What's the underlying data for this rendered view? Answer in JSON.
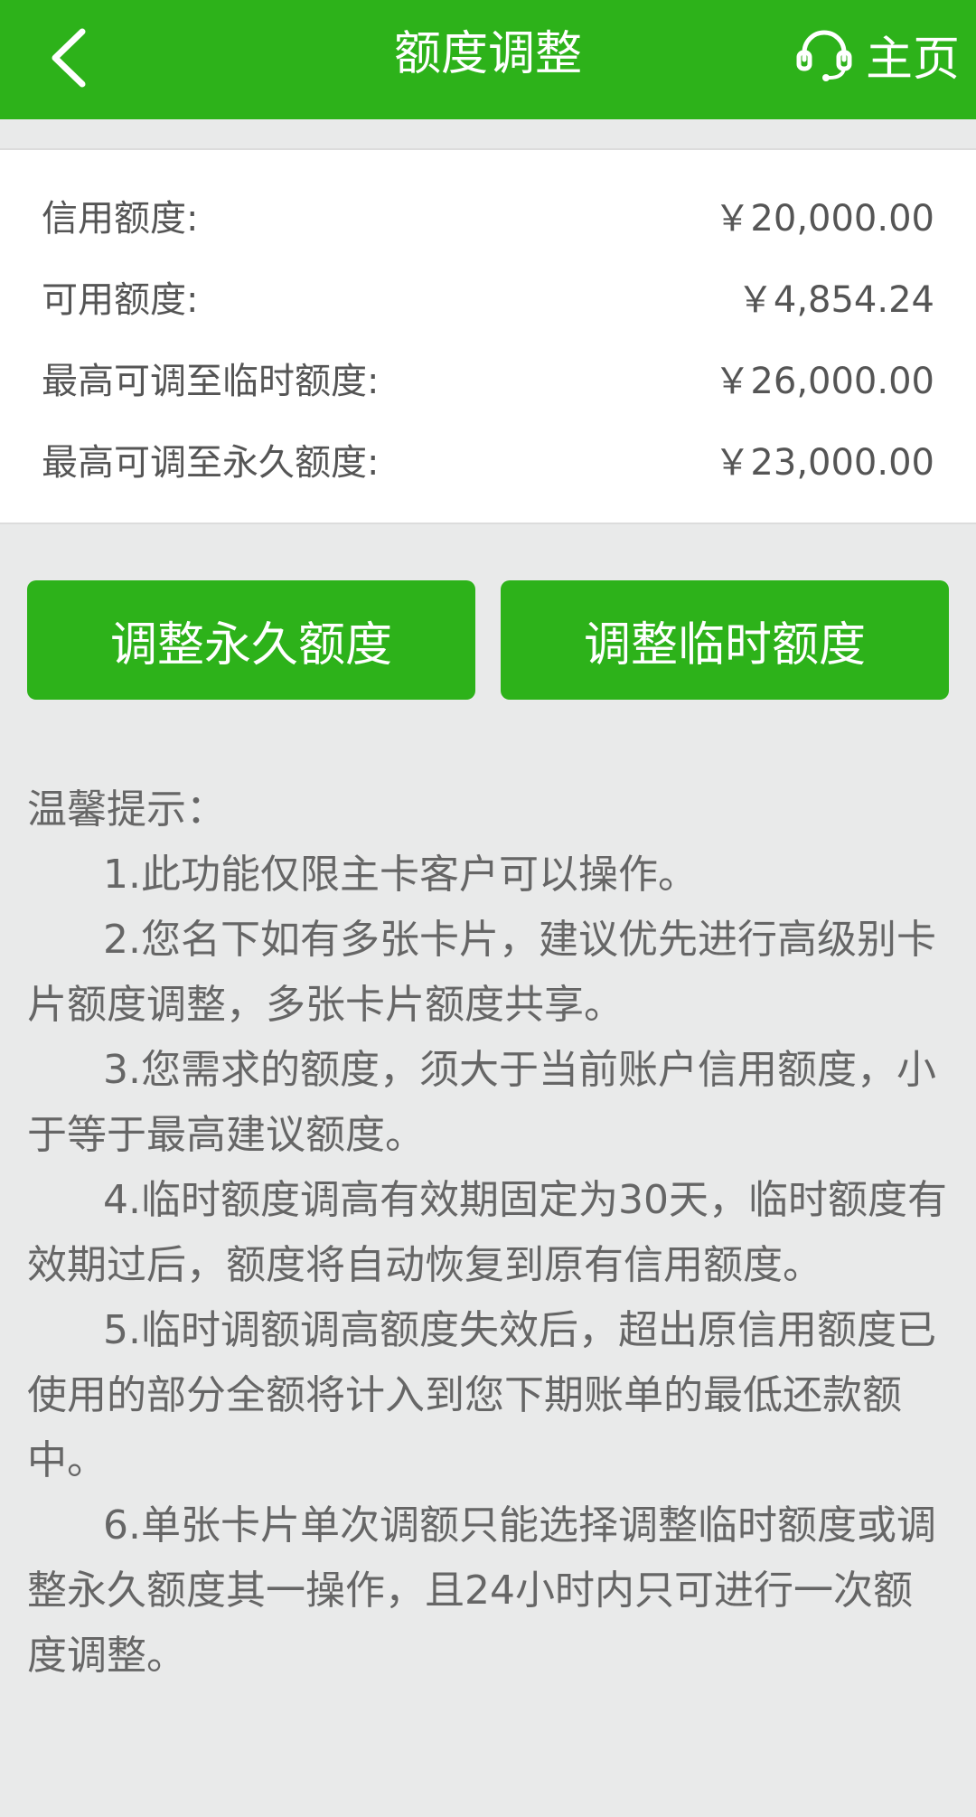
{
  "header": {
    "title": "额度调整",
    "home_label": "主页",
    "back_icon": "chevron-left-icon",
    "home_icon": "headset-icon",
    "accent_color": "#2db21a"
  },
  "limits": [
    {
      "label": "信用额度:",
      "value": "￥20,000.00"
    },
    {
      "label": "可用额度:",
      "value": "￥4,854.24"
    },
    {
      "label": "最高可调至临时额度:",
      "value": "￥26,000.00"
    },
    {
      "label": "最高可调至永久额度:",
      "value": "￥23,000.00"
    }
  ],
  "actions": {
    "permanent_label": "调整永久额度",
    "temporary_label": "调整临时额度"
  },
  "tips": {
    "title": "温馨提示：",
    "items": [
      "1.此功能仅限主卡客户可以操作。",
      "2.您名下如有多张卡片，建议优先进行高级别卡片额度调整，多张卡片额度共享。",
      "3.您需求的额度，须大于当前账户信用额度，小于等于最高建议额度。",
      "4.临时额度调高有效期固定为30天，临时额度有效期过后，额度将自动恢复到原有信用额度。",
      "5.临时调额调高额度失效后，超出原信用额度已使用的部分全额将计入到您下期账单的最低还款额中。",
      "6.单张卡片单次调额只能选择调整临时额度或调整永久额度其一操作，且24小时内只可进行一次额度调整。"
    ]
  }
}
